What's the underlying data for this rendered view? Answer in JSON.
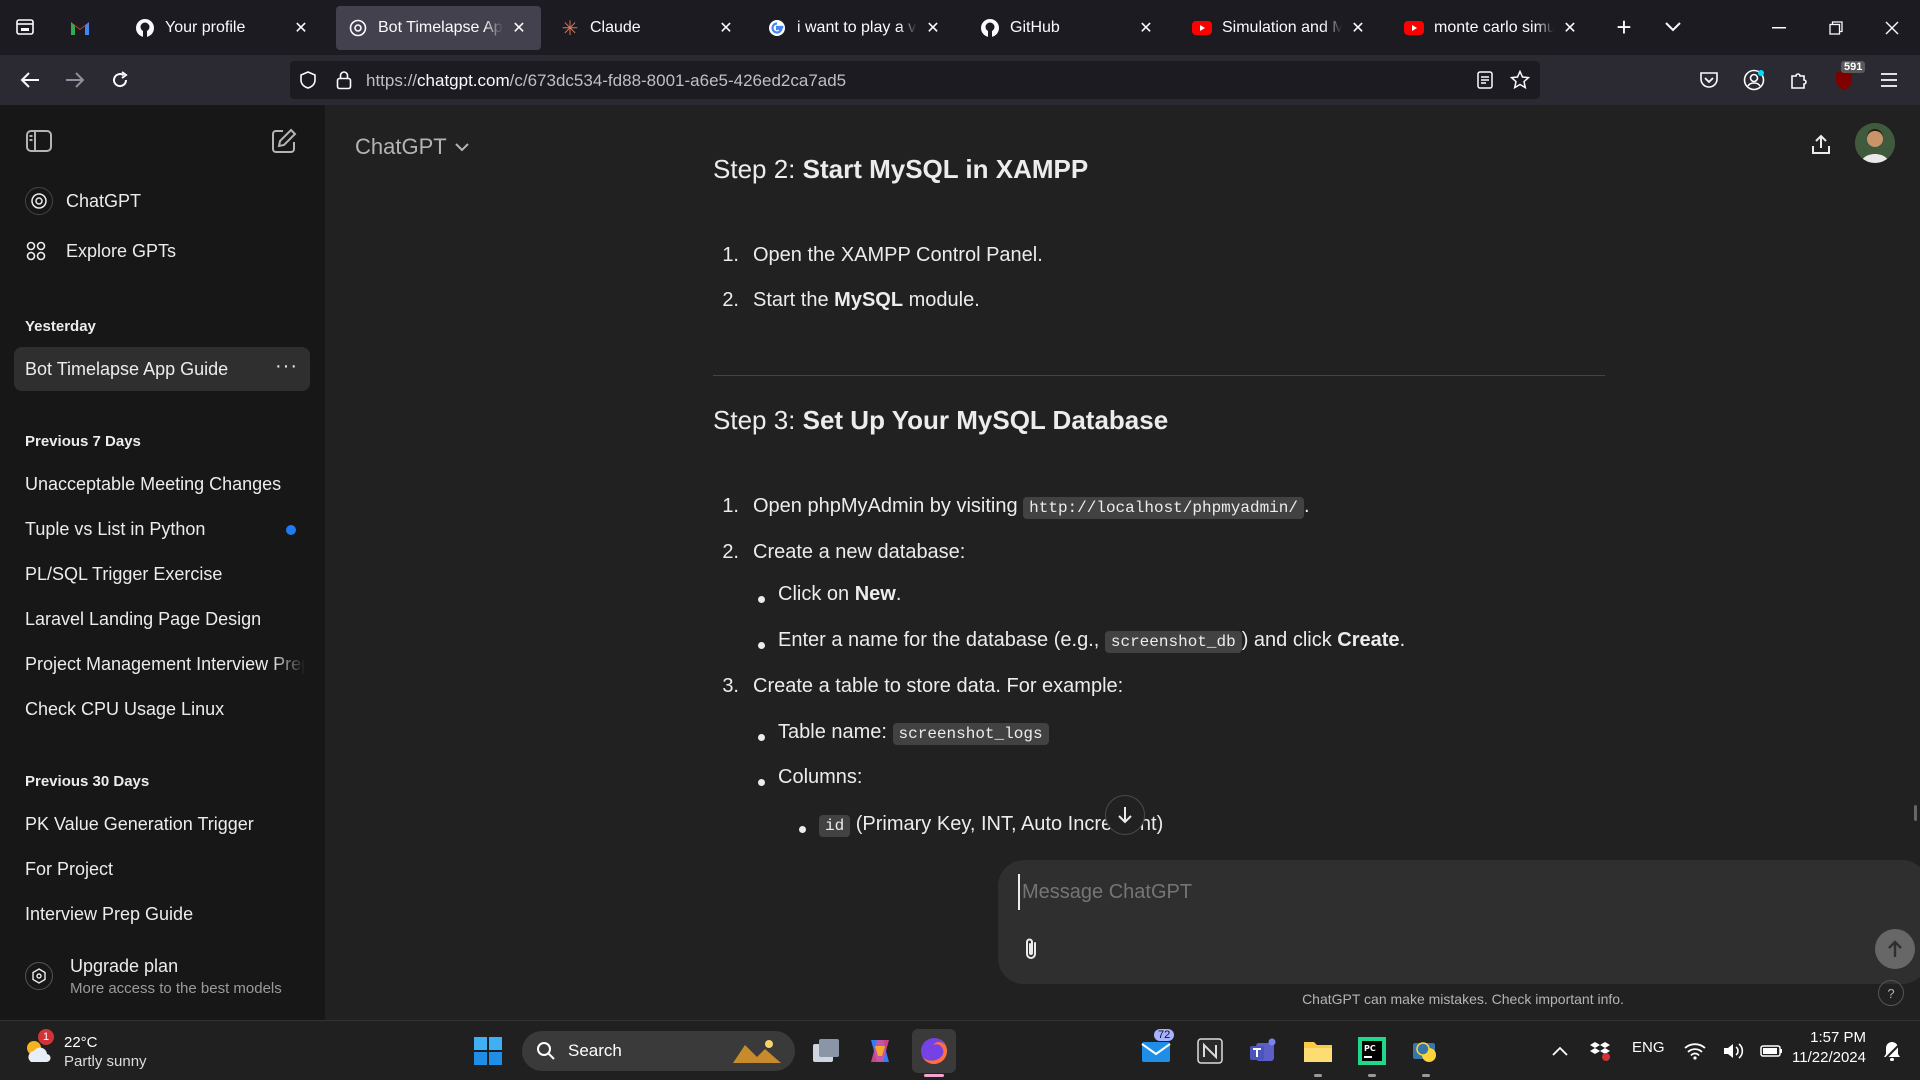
{
  "browser": {
    "tabs": [
      {
        "title": "",
        "icon": "gmail-icon"
      },
      {
        "title": "Your profile",
        "icon": "github-icon"
      },
      {
        "title": "Bot Timelapse App Guide",
        "icon": "chatgpt-icon",
        "active": true
      },
      {
        "title": "Claude",
        "icon": "claude-icon"
      },
      {
        "title": "i want to play a video",
        "icon": "google-icon"
      },
      {
        "title": "GitHub",
        "icon": "github-icon"
      },
      {
        "title": "Simulation and Modeling",
        "icon": "youtube-icon"
      },
      {
        "title": "monte carlo simulation",
        "icon": "youtube-icon"
      }
    ],
    "url_prefix": "https://",
    "url_host": "chatgpt.com",
    "url_path": "/c/673dc534-fd88-8001-a6e5-426ed2ca7ad5",
    "extension_badge": "591"
  },
  "sidebar": {
    "nav": [
      {
        "label": "ChatGPT",
        "icon": "chatgpt-icon"
      },
      {
        "label": "Explore GPTs",
        "icon": "grid-icon"
      }
    ],
    "sections": [
      {
        "heading": "Yesterday",
        "items": [
          {
            "label": "Bot Timelapse App Guide",
            "active": true
          }
        ]
      },
      {
        "heading": "Previous 7 Days",
        "items": [
          {
            "label": "Unacceptable Meeting Changes"
          },
          {
            "label": "Tuple vs List in Python",
            "unread": true
          },
          {
            "label": "PL/SQL Trigger Exercise"
          },
          {
            "label": "Laravel Landing Page Design"
          },
          {
            "label": "Project Management Interview Prep"
          },
          {
            "label": "Check CPU Usage Linux"
          }
        ]
      },
      {
        "heading": "Previous 30 Days",
        "items": [
          {
            "label": "PK Value Generation Trigger"
          },
          {
            "label": "For Project"
          },
          {
            "label": "Interview Prep Guide"
          }
        ]
      }
    ],
    "upgrade": {
      "title": "Upgrade plan",
      "subtitle": "More access to the best models"
    }
  },
  "header": {
    "model": "ChatGPT"
  },
  "content": {
    "step2": {
      "prefix": "Step 2: ",
      "title": "Start MySQL in XAMPP",
      "items": [
        "Open the XAMPP Control Panel.",
        "Start the ",
        "MySQL",
        " module."
      ]
    },
    "step3": {
      "prefix": "Step 3: ",
      "title": "Set Up Your MySQL Database"
    },
    "s3_1": {
      "num": "1.",
      "a": "Open phpMyAdmin by visiting ",
      "code": "http://localhost/phpmyadmin/",
      "b": "."
    },
    "s3_2": {
      "num": "2.",
      "text": "Create a new database:"
    },
    "s3_2a": {
      "a": "Click on ",
      "bold": "New",
      "b": "."
    },
    "s3_2b": {
      "a": "Enter a name for the database (e.g., ",
      "code": "screenshot_db",
      "b": ") and click ",
      "bold": "Create",
      "c": "."
    },
    "s3_3": {
      "num": "3.",
      "text": "Create a table to store data. For example:"
    },
    "s3_3a": {
      "a": "Table name: ",
      "code": "screenshot_logs"
    },
    "s3_3b": {
      "text": "Columns:"
    },
    "s3_3c": {
      "code": "id",
      "text": " (Primary Key, INT, Auto Increment)"
    }
  },
  "composer": {
    "placeholder": "Message ChatGPT"
  },
  "disclaimer": "ChatGPT can make mistakes. Check important info.",
  "help": "?",
  "taskbar": {
    "weather": {
      "temp": "22°C",
      "desc": "Partly sunny",
      "badge": "1"
    },
    "search": "Search",
    "mail_badge": "72",
    "lang": "ENG",
    "time": "1:57 PM",
    "date": "11/22/2024"
  }
}
